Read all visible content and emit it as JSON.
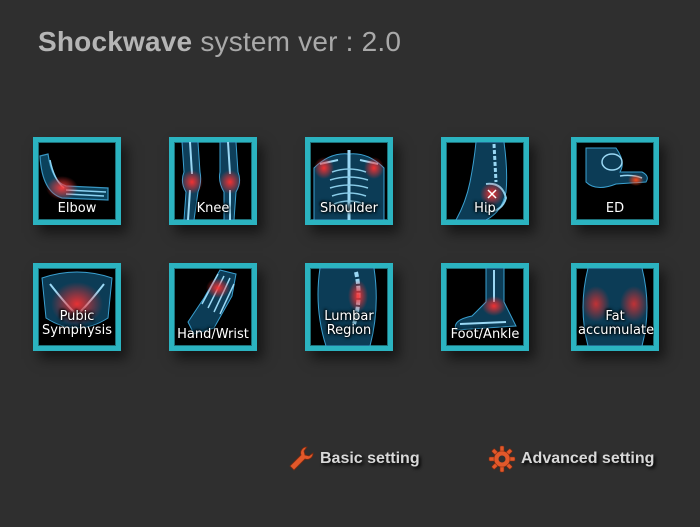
{
  "header": {
    "brand": "Shockwave",
    "subtitle": "system ver :",
    "version": "2.0"
  },
  "colors": {
    "background": "#2f2f2f",
    "tile_border": "#2bb3c0",
    "highlight": "#e03030",
    "icon_orange": "#e2582a"
  },
  "tiles": [
    {
      "label": "Elbow",
      "icon": "elbow-xray-icon"
    },
    {
      "label": "Knee",
      "icon": "knee-xray-icon"
    },
    {
      "label": "Shoulder",
      "icon": "shoulder-xray-icon"
    },
    {
      "label": "Hip",
      "icon": "hip-xray-icon"
    },
    {
      "label": "ED",
      "icon": "ed-xray-icon"
    },
    {
      "label": "Pubic Symphysis",
      "icon": "pubic-symphysis-xray-icon"
    },
    {
      "label": "Hand/Wrist",
      "icon": "hand-wrist-xray-icon"
    },
    {
      "label": "Lumbar Region",
      "icon": "lumbar-region-xray-icon"
    },
    {
      "label": "Foot/Ankle",
      "icon": "foot-ankle-xray-icon"
    },
    {
      "label": "Fat accumulate",
      "icon": "fat-accumulate-xray-icon"
    }
  ],
  "footer": {
    "basic_label": "Basic setting",
    "basic_icon": "wrench-icon",
    "advanced_label": "Advanced setting",
    "advanced_icon": "gear-icon"
  }
}
